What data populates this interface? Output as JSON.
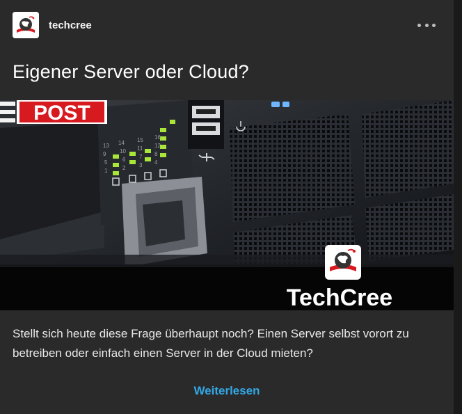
{
  "post": {
    "blog_name": "techcree",
    "title": "Eigener Server oder Cloud?",
    "image": {
      "badge_text": "POST",
      "brand_text": "TechCree",
      "port_labels": [
        "13",
        "14",
        "15",
        "16",
        "9",
        "10",
        "11",
        "12",
        "5",
        "6",
        "7",
        "8",
        "1",
        "2",
        "3",
        "4"
      ]
    },
    "excerpt": "Stellt sich heute diese Frage überhaupt noch? Einen Server selbst vorort zu betreiben oder einfach einen Server in der Cloud mieten?",
    "read_more_label": "Weiterlesen"
  },
  "icons": {
    "more": "more-horizontal-icon",
    "avatar": "globe-book-logo",
    "usb": "usb-icon",
    "power": "power-icon"
  },
  "colors": {
    "card_bg": "#2a2a2a",
    "link": "#33a8e6",
    "badge_red": "#d71920",
    "led_green": "#a8e63a",
    "led_blue": "#6fb6ff"
  }
}
